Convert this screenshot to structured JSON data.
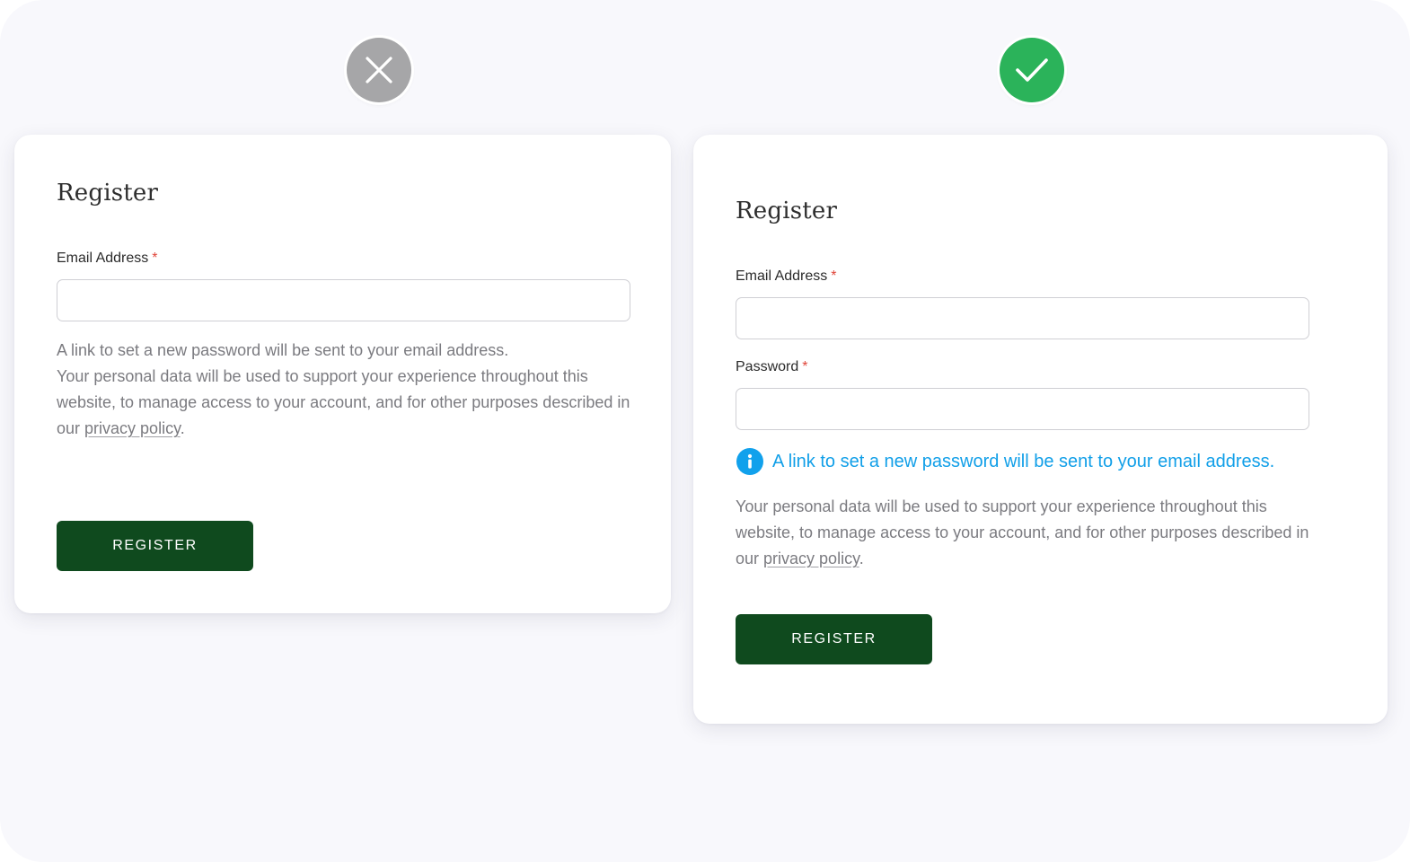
{
  "colors": {
    "background": "#f8f8fc",
    "card": "#ffffff",
    "bad_badge": "#a6a6a8",
    "good_badge": "#2bb35a",
    "button": "#0f4a1e",
    "required_asterisk": "#e0453a",
    "info_blue": "#119fe8",
    "muted_text": "#7b7b80"
  },
  "bad_example": {
    "badge_icon": "close-icon",
    "title": "Register",
    "email_label": "Email Address",
    "required_mark": "*",
    "email_value": "",
    "note_line": "A link to set a new password will be sent to your email address.",
    "privacy_text": "Your personal data will be used to support your experience throughout this website, to manage access to your account, and for other purposes described in our ",
    "privacy_link": "privacy policy",
    "privacy_end": ".",
    "button_label": "REGISTER"
  },
  "good_example": {
    "badge_icon": "check-icon",
    "title": "Register",
    "email_label": "Email Address",
    "password_label": "Password",
    "required_mark": "*",
    "email_value": "",
    "password_value": "",
    "info_icon": "info-icon",
    "info_message": "A link to set a new password will be sent to your email address.",
    "privacy_text": "Your personal data will be used to support your experience throughout this website, to manage access to your account, and for other purposes described in our ",
    "privacy_link": "privacy policy",
    "privacy_end": ".",
    "button_label": "REGISTER"
  }
}
